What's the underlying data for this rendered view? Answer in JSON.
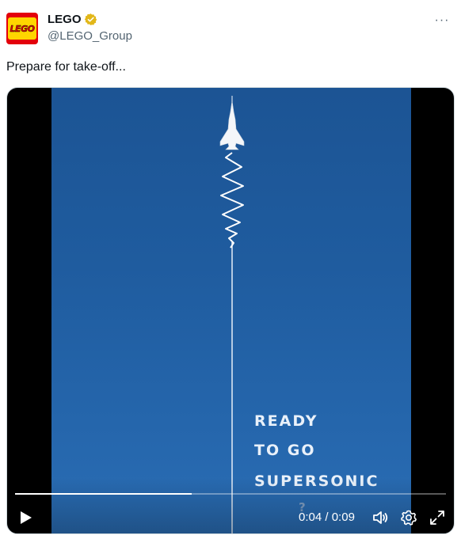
{
  "author": {
    "display_name": "LEGO",
    "handle": "@LEGO_Group",
    "avatar_text": "LEGO",
    "verified_icon": "verified-badge-icon",
    "verified_color": "#e2b719"
  },
  "post": {
    "text": "Prepare for take-off..."
  },
  "more_menu": {
    "icon": "more-horizontal-icon",
    "label": "···"
  },
  "video": {
    "overlay_lines": [
      "READY",
      "TO GO",
      "SUPERSONIC"
    ],
    "overlay_mark": "?",
    "current_time": "0:04",
    "duration": "0:09",
    "time_separator": "/",
    "progress_fraction": 0.41,
    "frame_color": "#1f5c9f",
    "controls": {
      "play_icon": "play-icon",
      "volume_icon": "volume-icon",
      "settings_icon": "settings-gear-icon",
      "fullscreen_icon": "fullscreen-icon"
    }
  }
}
